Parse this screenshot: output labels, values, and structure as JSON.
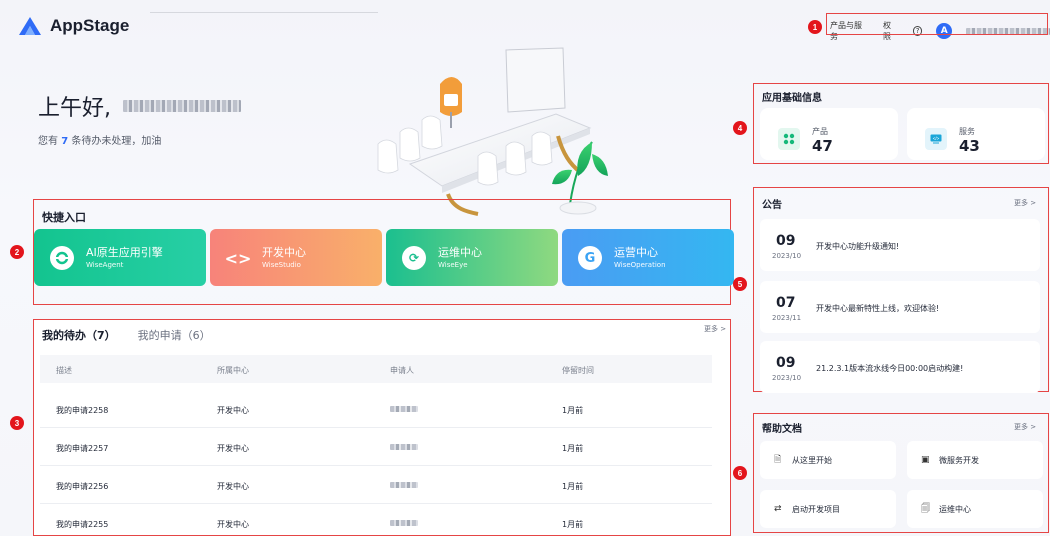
{
  "header": {
    "app_name": "AppStage",
    "links": [
      "产品与服务",
      "权限"
    ],
    "help_icon": "?",
    "avatar_letter": "A"
  },
  "greeting": {
    "hello": "上午好,",
    "todo_prefix": "您有",
    "todo_count": "7",
    "todo_suffix": "条待办未处理，加油"
  },
  "quick": {
    "title": "快捷入口",
    "cards": [
      {
        "name": "AI原生应用引擎",
        "sub": "WiseAgent",
        "icon": "ai-engine-icon",
        "color": "#16c79a"
      },
      {
        "name": "开发中心",
        "sub": "WiseStudio",
        "icon": "code-icon",
        "color": "#f58a6b"
      },
      {
        "name": "运维中心",
        "sub": "WiseEye",
        "icon": "ops-icon",
        "color": "#27c7a0"
      },
      {
        "name": "运营中心",
        "sub": "WiseOperation",
        "icon": "operation-icon",
        "color": "#3aa3f4"
      }
    ]
  },
  "todo": {
    "tab_active": "我的待办（7）",
    "tab_other": "我的申请（6）",
    "more": "更多 >",
    "columns": [
      "描述",
      "所属中心",
      "申请人",
      "停留时间"
    ],
    "rows": [
      {
        "desc": "我的申请2258",
        "center": "开发中心",
        "time": "1月前"
      },
      {
        "desc": "我的申请2257",
        "center": "开发中心",
        "time": "1月前"
      },
      {
        "desc": "我的申请2256",
        "center": "开发中心",
        "time": "1月前"
      },
      {
        "desc": "我的申请2255",
        "center": "开发中心",
        "time": "1月前"
      }
    ]
  },
  "app_info": {
    "title": "应用基础信息",
    "products_label": "产品",
    "products_value": "47",
    "services_label": "服务",
    "services_value": "43"
  },
  "notices": {
    "title": "公告",
    "more": "更多 >",
    "items": [
      {
        "day": "09",
        "ym": "2023/10",
        "text": "开发中心功能升级通知!"
      },
      {
        "day": "07",
        "ym": "2023/11",
        "text": "开发中心最新特性上线，欢迎体验!"
      },
      {
        "day": "09",
        "ym": "2023/10",
        "text": "21.2.3.1版本流水线今日00:00启动构建!"
      }
    ]
  },
  "docs": {
    "title": "帮助文档",
    "more": "更多 >",
    "items": [
      "从这里开始",
      "微服务开发",
      "启动开发项目",
      "运维中心"
    ]
  },
  "markers": [
    "1",
    "2",
    "3",
    "4",
    "5",
    "6"
  ]
}
